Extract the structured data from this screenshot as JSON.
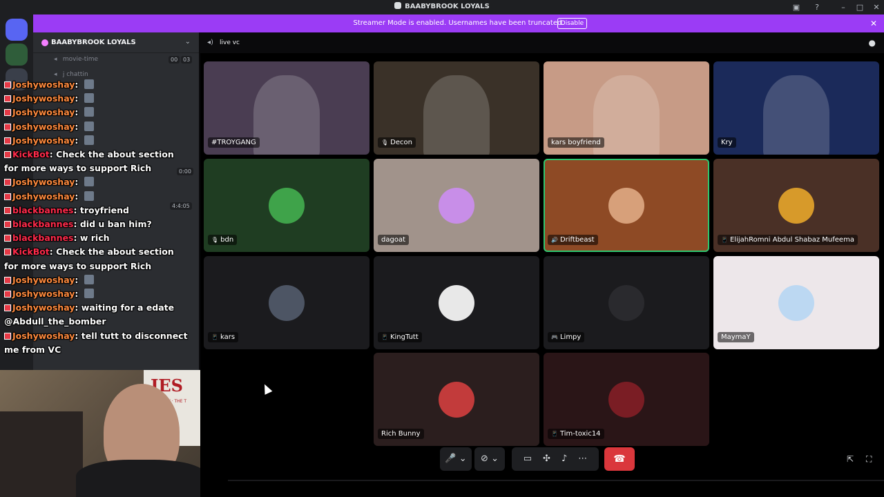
{
  "window": {
    "title": "BAABYBROOK LOYALS",
    "controls": [
      "inbox-icon",
      "help-icon",
      "minimize-icon",
      "maximize-icon",
      "close-icon"
    ]
  },
  "banner": {
    "message": "Streamer Mode is enabled. Usernames have been truncated.",
    "button": "Disable"
  },
  "server": {
    "name": "BAABYBROOK LOYALS"
  },
  "channels": [
    {
      "name": "movie-time",
      "type": "voice"
    },
    {
      "name": "j chattin",
      "type": "voice"
    }
  ],
  "timers": [
    "00",
    "03",
    "0:00",
    "4:4:05"
  ],
  "chat": [
    {
      "user": "Joshywoshay",
      "text": "",
      "userColor": "#ff8a3d"
    },
    {
      "user": "Joshywoshay",
      "text": "",
      "userColor": "#ff8a3d"
    },
    {
      "user": "Joshywoshay",
      "text": "",
      "userColor": "#ff8a3d"
    },
    {
      "user": "Joshywoshay",
      "text": "",
      "userColor": "#ff8a3d"
    },
    {
      "user": "Joshywoshay",
      "text": "",
      "userColor": "#ff8a3d"
    },
    {
      "user": "KickBot",
      "text": "Check the about section",
      "userColor": "#ff2a4a"
    },
    {
      "user": "",
      "text": "for more ways to support Rich",
      "userColor": "#ffffff"
    },
    {
      "user": "Joshywoshay",
      "text": "",
      "userColor": "#ff8a3d"
    },
    {
      "user": "Joshywoshay",
      "text": "",
      "userColor": "#ff8a3d"
    },
    {
      "user": "blackbannes",
      "text": "troyfriend",
      "userColor": "#ff2a4a"
    },
    {
      "user": "blackbannes",
      "text": "did u ban him?",
      "userColor": "#ff2a4a"
    },
    {
      "user": "blackbannes",
      "text": "w rich",
      "userColor": "#ff2a4a"
    },
    {
      "user": "KickBot",
      "text": "Check the about section",
      "userColor": "#ff2a4a"
    },
    {
      "user": "",
      "text": "for more ways to support Rich",
      "userColor": "#ffffff"
    },
    {
      "user": "Joshywoshay",
      "text": "",
      "userColor": "#ff8a3d"
    },
    {
      "user": "Joshywoshay",
      "text": "",
      "userColor": "#ff8a3d"
    },
    {
      "user": "Joshywoshay",
      "text": "waiting for a edate",
      "userColor": "#ff8a3d"
    },
    {
      "user": "",
      "text": "@Abdull_the_bomber",
      "userColor": "#ffffff"
    },
    {
      "user": "Joshywoshay",
      "text": "tell tutt to disconnect",
      "userColor": "#ff8a3d"
    },
    {
      "user": "",
      "text": "me from VC",
      "userColor": "#ffffff"
    }
  ],
  "vc": {
    "name": "live vc"
  },
  "tiles": [
    {
      "name": "#TROYGANG",
      "bg": "#4a3d52",
      "kind": "video",
      "icon": ""
    },
    {
      "name": "Decon",
      "bg": "#3a3128",
      "kind": "video",
      "icon": "🎙"
    },
    {
      "name": "kars boyfriend",
      "bg": "#c79b86",
      "kind": "video",
      "icon": ""
    },
    {
      "name": "Kry",
      "bg": "#1b2a5a",
      "kind": "video",
      "icon": ""
    },
    {
      "name": "bdn",
      "bg": "#1f3d22",
      "kind": "avatar",
      "av": "#3fa34a",
      "icon": "🎙"
    },
    {
      "name": "dagoat",
      "bg": "#a1938b",
      "kind": "avatar",
      "av": "#c88ee8",
      "icon": ""
    },
    {
      "name": "Driftbeast",
      "bg": "#8e4a25",
      "kind": "avatar",
      "av": "#d7a07a",
      "icon": "🔊",
      "speaking": true
    },
    {
      "name": "ElijahRomni Abdul Shabaz Mufeema",
      "bg": "#4a3026",
      "kind": "avatar",
      "av": "#d79a2a",
      "icon": "📱"
    },
    {
      "name": "kars",
      "bg": "#1b1b1e",
      "kind": "avatar",
      "av": "#4d5564",
      "icon": "📱"
    },
    {
      "name": "KingTutt",
      "bg": "#1b1b1e",
      "kind": "avatar",
      "av": "#e8e8e8",
      "icon": "📱"
    },
    {
      "name": "Limpy",
      "bg": "#1b1b1e",
      "kind": "avatar",
      "av": "#2a2a2e",
      "icon": "🎮"
    },
    {
      "name": "MaymaY",
      "bg": "#ede7ea",
      "kind": "avatar",
      "av": "#bcd8f2",
      "icon": ""
    },
    {
      "name": "Rich Bunny",
      "bg": "#2b1e1e",
      "kind": "avatar",
      "av": "#c23b3b",
      "icon": ""
    },
    {
      "name": "Tim-toxic14",
      "bg": "#2a1517",
      "kind": "avatar",
      "av": "#7a1d24",
      "icon": "📱"
    }
  ],
  "controls": [
    "microphone-icon",
    "camera-icon",
    "screenshare-icon",
    "activities-icon",
    "soundboard-icon",
    "more-icon",
    "hangup-icon"
  ],
  "webcam": {
    "flag_text": "JES",
    "flag_sub": "THE WAY · THE T"
  }
}
